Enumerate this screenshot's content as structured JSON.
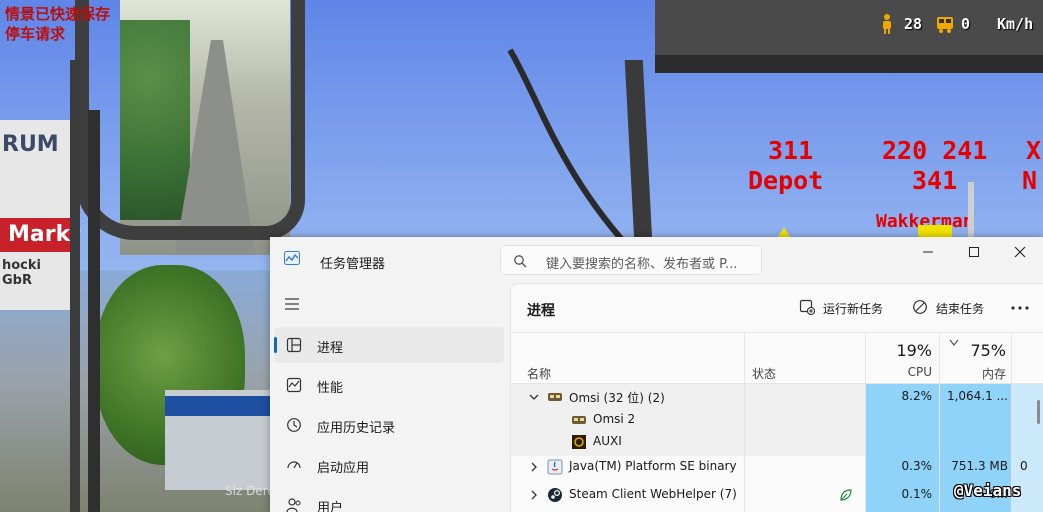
{
  "game": {
    "messages": [
      "情景已快速保存",
      "停车请求"
    ],
    "hud": {
      "passengers": "28",
      "stops": "0",
      "speed_unit": "Km/h"
    },
    "destinations": {
      "sign1_line": "311",
      "sign1_dest": "Depot",
      "sign2_line": "220 241",
      "sign2_line_b": "341",
      "sign3_a": "X",
      "sign3_b": "N",
      "street_sign": "Wakkerman"
    },
    "billboard": {
      "title": "RUM",
      "market": "Markt",
      "company": "hocki GbR"
    },
    "location_text": "Slz Dererntoten Sud S Bahn",
    "watermark": "@Veians"
  },
  "taskmgr": {
    "title": "任务管理器",
    "search_placeholder": "键入要搜索的名称、发布者或 P...",
    "window_buttons": [
      "minimize",
      "maximize",
      "close"
    ],
    "nav": [
      {
        "label": "进程",
        "icon": "processes-icon",
        "active": true
      },
      {
        "label": "性能",
        "icon": "performance-icon"
      },
      {
        "label": "应用历史记录",
        "icon": "app-history-icon"
      },
      {
        "label": "启动应用",
        "icon": "startup-icon"
      },
      {
        "label": "用户",
        "icon": "users-icon"
      }
    ],
    "page_title": "进程",
    "actions": {
      "run_new_task": "运行新任务",
      "end_task": "结束任务"
    },
    "columns": {
      "name": "名称",
      "status": "状态",
      "cpu_pct": "19%",
      "cpu_label": "CPU",
      "mem_pct": "75%",
      "mem_label": "内存"
    },
    "rows": [
      {
        "name": "Omsi (32 位) (2)",
        "cpu": "8.2%",
        "mem": "1,064.1 ...",
        "expanded": true,
        "icon": "bus-app-icon"
      },
      {
        "name": "Omsi 2",
        "child": true,
        "icon": "bus-app-icon"
      },
      {
        "name": "AUXI",
        "child": true,
        "icon": "auxi-icon"
      },
      {
        "name": "Java(TM) Platform SE binary",
        "cpu": "0.3%",
        "mem": "751.3 MB",
        "extra": "0",
        "icon": "java-icon"
      },
      {
        "name": "Steam Client WebHelper (7)",
        "cpu": "0.1%",
        "mem": "6...",
        "icon": "steam-icon",
        "status_icon": "efficiency-leaf-icon"
      }
    ]
  },
  "colors": {
    "accent": "#0f6cbd",
    "cpu_heat": "#8fd3f8",
    "led_red": "#e60000",
    "message_red": "#b81010"
  }
}
